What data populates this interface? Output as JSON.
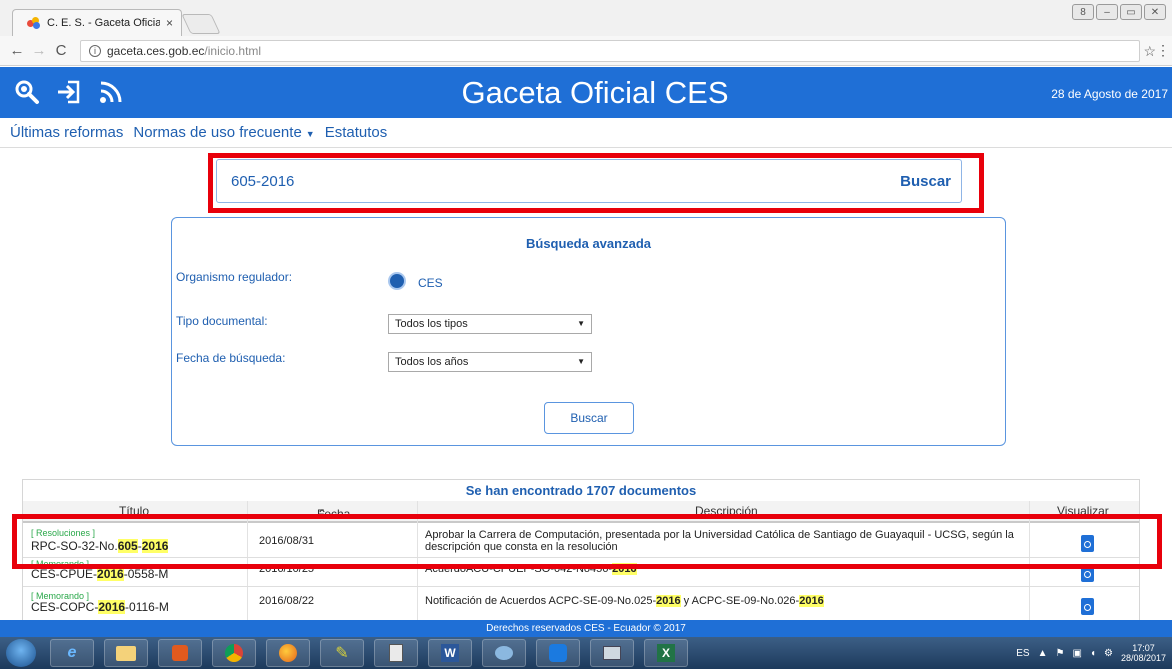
{
  "browser": {
    "tab_title": "C. E. S. - Gaceta Oficial",
    "tab_close": "×",
    "url_host": "gaceta.ces.gob.ec",
    "url_path": "/inicio.html",
    "window_buttons": [
      "8",
      "–",
      "▭",
      "✕"
    ]
  },
  "header": {
    "title": "Gaceta Oficial CES",
    "date": "28 de Agosto de 2017",
    "icons": [
      "search-icon",
      "login-icon",
      "rss-icon"
    ]
  },
  "nav": {
    "items": [
      "Últimas reformas",
      "Normas de uso frecuente",
      "Estatutos"
    ]
  },
  "search": {
    "value": "605-2016",
    "button": "Buscar"
  },
  "advanced": {
    "title": "Búsqueda avanzada",
    "organismo_label": "Organismo regulador:",
    "organismo_value": "CES",
    "tipo_label": "Tipo documental:",
    "tipo_value": "Todos los tipos",
    "fecha_label": "Fecha de búsqueda:",
    "fecha_value": "Todos los años",
    "button": "Buscar"
  },
  "results": {
    "title": "Se han encontrado 1707 documentos",
    "columns": [
      "Título",
      "Fecha",
      "Descripción",
      "Visualizar"
    ],
    "rows": [
      {
        "category": "[ Resoluciones ]",
        "code_prefix": "RPC-SO-32-No.",
        "code_hl1": "605",
        "code_mid": "-",
        "code_hl2": "2016",
        "code_suffix": "",
        "date": "2016/08/31",
        "desc": "Aprobar la Carrera de Computación, presentada por la Universidad Católica de Santiago de Guayaquil - UCSG, según la descripción que consta en la resolución"
      },
      {
        "category": "[ Memorando ]",
        "code_prefix": "CES-CPUE-",
        "code_hl1": "2016",
        "code_mid": "-0558-M",
        "code_hl2": "",
        "code_suffix": "",
        "date": "2016/10/25",
        "desc_prefix": "AcuerdoACU-CPUEP-SO-042-No456-",
        "desc_hl": "2016"
      },
      {
        "category": "[ Memorando ]",
        "code_prefix": "CES-COPC-",
        "code_hl1": "2016",
        "code_mid": "-0116-M",
        "code_hl2": "",
        "code_suffix": "",
        "date": "2016/08/22",
        "desc_prefix": "Notificación de Acuerdos ACPC-SE-09-No.025-",
        "desc_hl": "2016",
        "desc_mid": " y ACPC-SE-09-No.026-",
        "desc_hl2": "2016"
      }
    ]
  },
  "footer": {
    "text": "Derechos reservados CES - Ecuador © 2017"
  },
  "taskbar": {
    "lang": "ES",
    "time": "17:07",
    "date": "28/08/2017"
  },
  "colors": {
    "brand_blue": "#1f6fd6",
    "highlight_red": "#e8000b",
    "highlight_yellow": "#ffff66"
  }
}
